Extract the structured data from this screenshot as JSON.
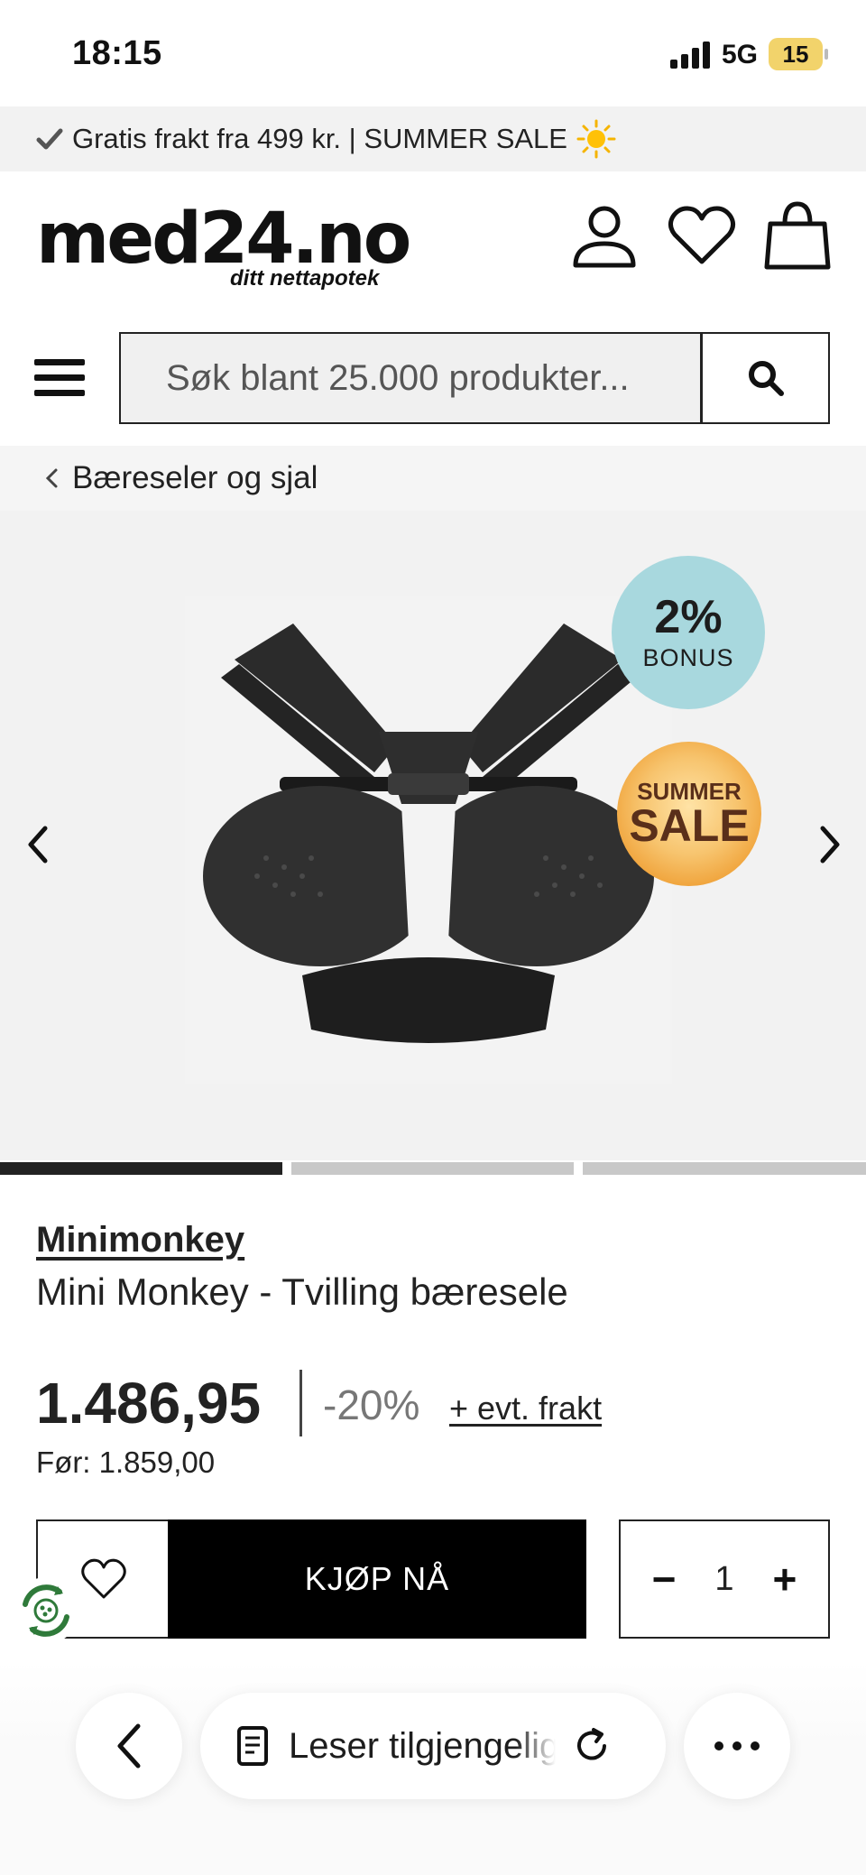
{
  "status_bar": {
    "time": "18:15",
    "network": "5G",
    "battery": "15"
  },
  "promo": {
    "text": "Gratis frakt fra 499 kr. | SUMMER SALE"
  },
  "header": {
    "logo_main": "med24.no",
    "logo_sub": "ditt nettapotek"
  },
  "search": {
    "placeholder": "Søk blant 25.000 produkter..."
  },
  "breadcrumb": {
    "label": "Bæreseler og sjal"
  },
  "gallery": {
    "bonus_percent": "2%",
    "bonus_label": "BONUS",
    "sale_top": "SUMMER",
    "sale_bottom": "SALE",
    "slide_count": 3,
    "active_slide": 1
  },
  "product": {
    "brand": "Minimonkey",
    "title": "Mini Monkey - Tvilling bæresele",
    "price": "1.486,95",
    "discount": "-20%",
    "shipping_link": "+ evt. frakt",
    "before_price": "Før: 1.859,00"
  },
  "purchase": {
    "buy_label": "KJØP NÅ",
    "quantity": "1",
    "minus": "−",
    "plus": "+"
  },
  "browser_toolbar": {
    "reader_label": "Leser tilgjengelig"
  },
  "colors": {
    "bonus_badge": "#a8d8de",
    "sale_badge": "#f0a43c",
    "buy_button": "#000000",
    "indicator_active": "#222222",
    "indicator_inactive": "#c8c8c8"
  }
}
